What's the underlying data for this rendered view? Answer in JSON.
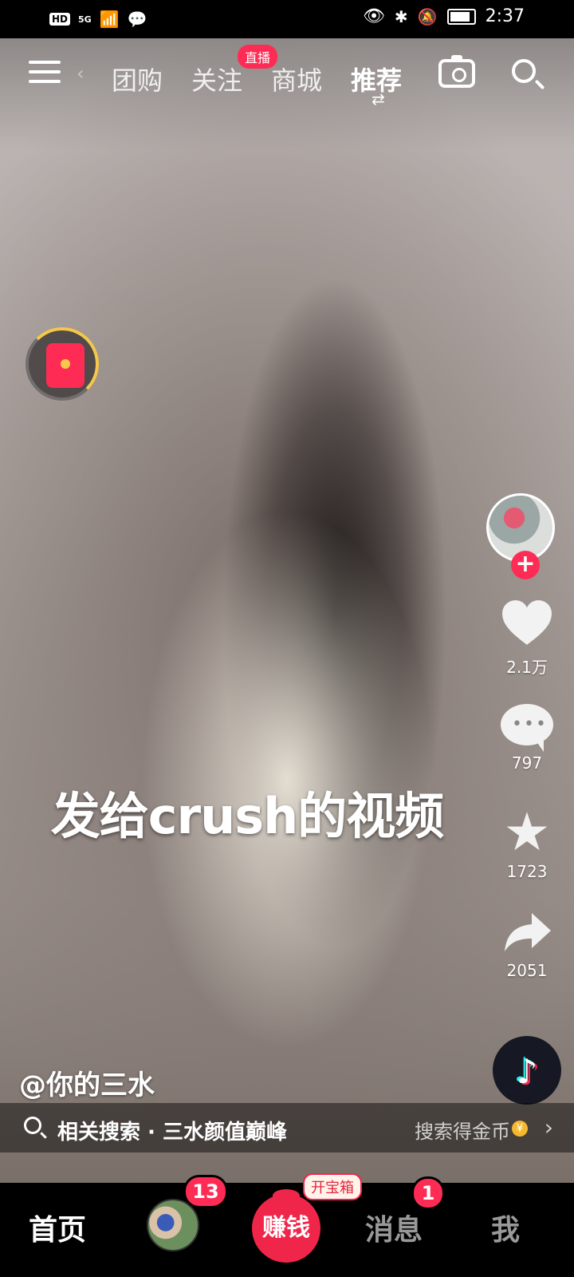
{
  "status_bar": {
    "left_icons": [
      "hd-icon",
      "5g-signal-icon",
      "wifi-icon",
      "wechat-icon"
    ],
    "hd": "HD",
    "network": "5G",
    "time": "2:37",
    "right_icons": [
      "eye-icon",
      "bluetooth-icon",
      "mute-bell-icon",
      "battery-icon"
    ]
  },
  "top_nav": {
    "tabs": [
      "团购",
      "关注",
      "商城",
      "推荐"
    ],
    "active_tab": "推荐",
    "follow_badge": "直播"
  },
  "video": {
    "caption": "发给crush的视频",
    "author": "@你的三水"
  },
  "actions": {
    "likes": "2.1万",
    "comments": "797",
    "favorites": "1723",
    "shares": "2051"
  },
  "related_search": {
    "text": "相关搜索 · 三水颜值巅峰",
    "reward": "搜索得金币"
  },
  "bottom_nav": {
    "home": "首页",
    "friends_badge": "13",
    "earn": "赚钱",
    "earn_tag": "开宝箱",
    "messages": "消息",
    "messages_badge": "1",
    "me": "我"
  },
  "colors": {
    "accent": "#fe2c55",
    "gold": "#f5c74a"
  }
}
